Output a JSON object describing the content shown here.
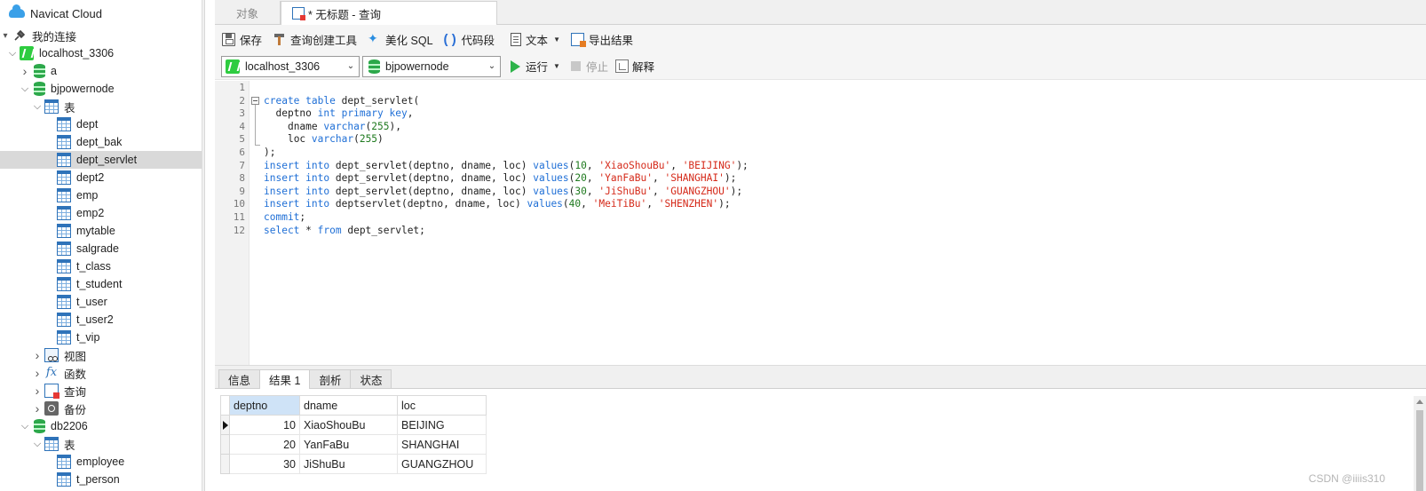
{
  "sidebar": {
    "cloud_label": "Navicat Cloud",
    "my_connections": "我的连接",
    "tree": [
      {
        "label": "localhost_3306",
        "icon": "connection-icon",
        "level": 1,
        "caret": "down"
      },
      {
        "label": "a",
        "icon": "database-icon",
        "level": 2,
        "caret": "right"
      },
      {
        "label": "bjpowernode",
        "icon": "database-icon",
        "level": 2,
        "caret": "down"
      },
      {
        "label": "表",
        "icon": "tables-folder-icon",
        "level": 3,
        "caret": "down"
      },
      {
        "label": "dept",
        "icon": "table-icon",
        "level": 4
      },
      {
        "label": "dept_bak",
        "icon": "table-icon",
        "level": 4
      },
      {
        "label": "dept_servlet",
        "icon": "table-icon",
        "level": 4,
        "selected": true
      },
      {
        "label": "dept2",
        "icon": "table-icon",
        "level": 4
      },
      {
        "label": "emp",
        "icon": "table-icon",
        "level": 4
      },
      {
        "label": "emp2",
        "icon": "table-icon",
        "level": 4
      },
      {
        "label": "mytable",
        "icon": "table-icon",
        "level": 4
      },
      {
        "label": "salgrade",
        "icon": "table-icon",
        "level": 4
      },
      {
        "label": "t_class",
        "icon": "table-icon",
        "level": 4
      },
      {
        "label": "t_student",
        "icon": "table-icon",
        "level": 4
      },
      {
        "label": "t_user",
        "icon": "table-icon",
        "level": 4
      },
      {
        "label": "t_user2",
        "icon": "table-icon",
        "level": 4
      },
      {
        "label": "t_vip",
        "icon": "table-icon",
        "level": 4
      },
      {
        "label": "视图",
        "icon": "views-folder-icon",
        "level": 3,
        "caret": "right"
      },
      {
        "label": "函数",
        "icon": "functions-folder-icon",
        "level": 3,
        "caret": "right"
      },
      {
        "label": "查询",
        "icon": "queries-folder-icon",
        "level": 3,
        "caret": "right"
      },
      {
        "label": "备份",
        "icon": "backups-folder-icon",
        "level": 3,
        "caret": "right"
      },
      {
        "label": "db2206",
        "icon": "database-icon",
        "level": 2,
        "caret": "down"
      },
      {
        "label": "表",
        "icon": "tables-folder-icon",
        "level": 3,
        "caret": "down"
      },
      {
        "label": "employee",
        "icon": "table-icon",
        "level": 4
      },
      {
        "label": "t_person",
        "icon": "table-icon",
        "level": 4
      }
    ]
  },
  "tabs": {
    "objects_label": "对象",
    "active_label": "* 无标题 - 查询"
  },
  "toolbar": {
    "save": "保存",
    "query_builder": "查询创建工具",
    "beautify_sql": "美化 SQL",
    "code_snippet": "代码段",
    "text": "文本",
    "export_result": "导出结果"
  },
  "runbar": {
    "connection": "localhost_3306",
    "database": "bjpowernode",
    "run": "运行",
    "stop": "停止",
    "explain": "解释"
  },
  "editor": {
    "line_numbers": [
      "1",
      "2",
      "3",
      "4",
      "5",
      "6",
      "7",
      "8",
      "9",
      "10",
      "11",
      "12"
    ],
    "lines": [
      "",
      "create table dept_servlet(",
      "  deptno int primary key,",
      "    dname varchar(255),",
      "    loc varchar(255)",
      ");",
      "insert into dept_servlet(deptno, dname, loc) values(10, 'XiaoShouBu', 'BEIJING');",
      "insert into dept_servlet(deptno, dname, loc) values(20, 'YanFaBu', 'SHANGHAI');",
      "insert into dept_servlet(deptno, dname, loc) values(30, 'JiShuBu', 'GUANGZHOU');",
      "insert into deptservlet(deptno, dname, loc) values(40, 'MeiTiBu', 'SHENZHEN');",
      "commit;",
      "select * from dept_servlet;"
    ]
  },
  "result_tabs": [
    "信息",
    "结果 1",
    "剖析",
    "状态"
  ],
  "result_active_tab": "结果 1",
  "result_grid": {
    "columns": [
      "deptno",
      "dname",
      "loc"
    ],
    "rows": [
      [
        "10",
        "XiaoShouBu",
        "BEIJING"
      ],
      [
        "20",
        "YanFaBu",
        "SHANGHAI"
      ],
      [
        "30",
        "JiShuBu",
        "GUANGZHOU"
      ]
    ]
  },
  "watermark": "CSDN @iiiis310",
  "colors": {
    "keyword": "#1f6fd6",
    "string": "#d52a1a",
    "number": "#1f7a1f",
    "selection": "#d9d9d9"
  }
}
